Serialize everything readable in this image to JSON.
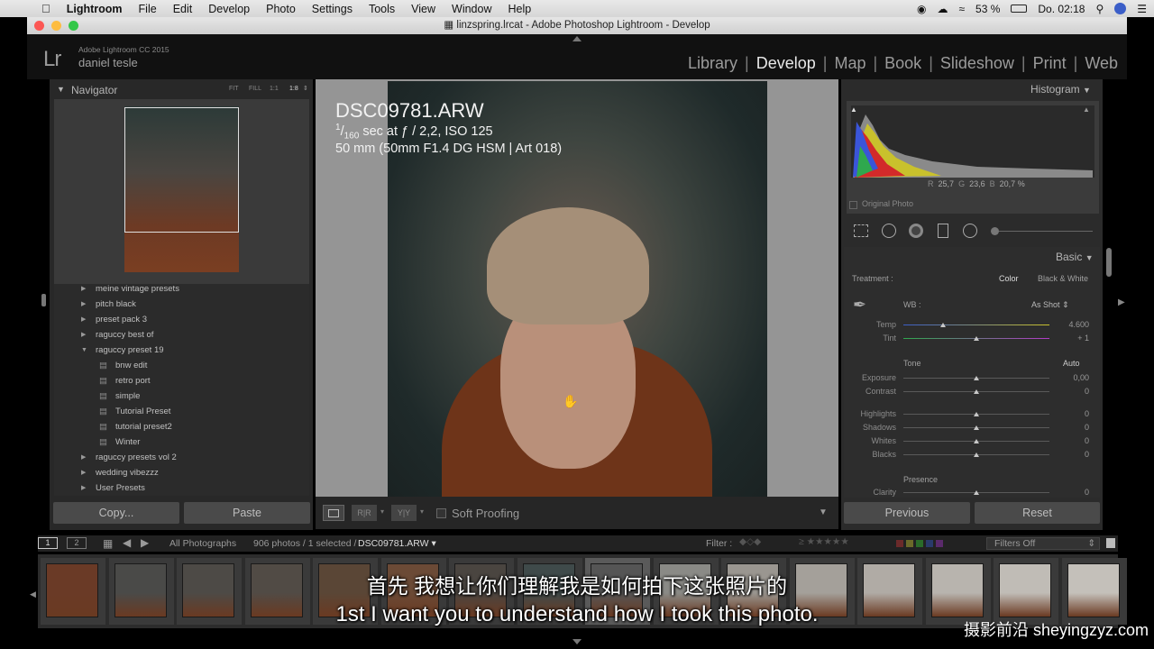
{
  "menubar": {
    "apple": "",
    "app": "Lightroom",
    "items": [
      "File",
      "Edit",
      "Develop",
      "Photo",
      "Settings",
      "Tools",
      "View",
      "Window",
      "Help"
    ],
    "battery": "53 %",
    "clock": "Do. 02:18"
  },
  "window": {
    "title": "linzspring.lrcat - Adobe Photoshop Lightroom - Develop"
  },
  "identity": {
    "logo": "Lr",
    "version": "Adobe Lightroom CC 2015",
    "user": "daniel tesle"
  },
  "modules": {
    "items": [
      "Library",
      "Develop",
      "Map",
      "Book",
      "Slideshow",
      "Print",
      "Web"
    ],
    "active": "Develop"
  },
  "navigator": {
    "title": "Navigator",
    "zoom": [
      "FIT",
      "FILL",
      "1:1",
      "1:8"
    ]
  },
  "presets": [
    {
      "label": "meine vintage presets",
      "type": "folder"
    },
    {
      "label": "pitch black",
      "type": "folder"
    },
    {
      "label": "preset pack 3",
      "type": "folder"
    },
    {
      "label": "raguccy best of",
      "type": "folder"
    },
    {
      "label": "raguccy preset 19",
      "type": "folder-open"
    },
    {
      "label": "bnw edit",
      "type": "preset"
    },
    {
      "label": "retro port",
      "type": "preset"
    },
    {
      "label": "simple",
      "type": "preset"
    },
    {
      "label": "Tutorial Preset",
      "type": "preset"
    },
    {
      "label": "tutorial preset2",
      "type": "preset"
    },
    {
      "label": "Winter",
      "type": "preset"
    },
    {
      "label": "raguccy presets vol 2",
      "type": "folder"
    },
    {
      "label": "wedding vibezzz",
      "type": "folder"
    },
    {
      "label": "User Presets",
      "type": "folder"
    }
  ],
  "leftbuttons": {
    "copy": "Copy...",
    "paste": "Paste"
  },
  "photoinfo": {
    "filename": "DSC09781.ARW",
    "exposure_num": "1",
    "exposure_den": "160",
    "exposure_rest": "sec at ƒ / 2,2, ISO 125",
    "lens": "50 mm (50mm F1.4 DG HSM | Art 018)"
  },
  "toolbar": {
    "soft_proofing": "Soft Proofing"
  },
  "histogram": {
    "title": "Histogram",
    "r_label": "R",
    "r": "25,7",
    "g_label": "G",
    "g": "23,6",
    "b_label": "B",
    "b": "20,7",
    "pct": "%",
    "original": "Original Photo"
  },
  "basic": {
    "title": "Basic",
    "treatment_label": "Treatment :",
    "color": "Color",
    "bw": "Black & White",
    "wb_label": "WB :",
    "wb_value": "As Shot",
    "tone_label": "Tone",
    "auto": "Auto",
    "presence_label": "Presence",
    "sliders": [
      {
        "label": "Temp",
        "value": "4.600",
        "pos": 0.27
      },
      {
        "label": "Tint",
        "value": "+ 1",
        "pos": 0.5
      },
      {
        "label": "Exposure",
        "value": "0,00",
        "pos": 0.5
      },
      {
        "label": "Contrast",
        "value": "0",
        "pos": 0.5
      },
      {
        "label": "Highlights",
        "value": "0",
        "pos": 0.5
      },
      {
        "label": "Shadows",
        "value": "0",
        "pos": 0.5
      },
      {
        "label": "Whites",
        "value": "0",
        "pos": 0.5
      },
      {
        "label": "Blacks",
        "value": "0",
        "pos": 0.5
      },
      {
        "label": "Clarity",
        "value": "0",
        "pos": 0.5
      }
    ]
  },
  "rightbuttons": {
    "previous": "Previous",
    "reset": "Reset"
  },
  "filterbar": {
    "screen1": "1",
    "screen2": "2",
    "source": "All Photographs",
    "count": "906 photos / 1 selected /",
    "selected": "DSC09781.ARW",
    "filter_label": "Filter :",
    "filters_off": "Filters Off"
  },
  "subtitles": {
    "zh": "首先 我想让你们理解我是如何拍下这张照片的",
    "en": "1st I want you to understand how I took this photo."
  },
  "watermark": "摄影前沿 sheyingzyz.com"
}
